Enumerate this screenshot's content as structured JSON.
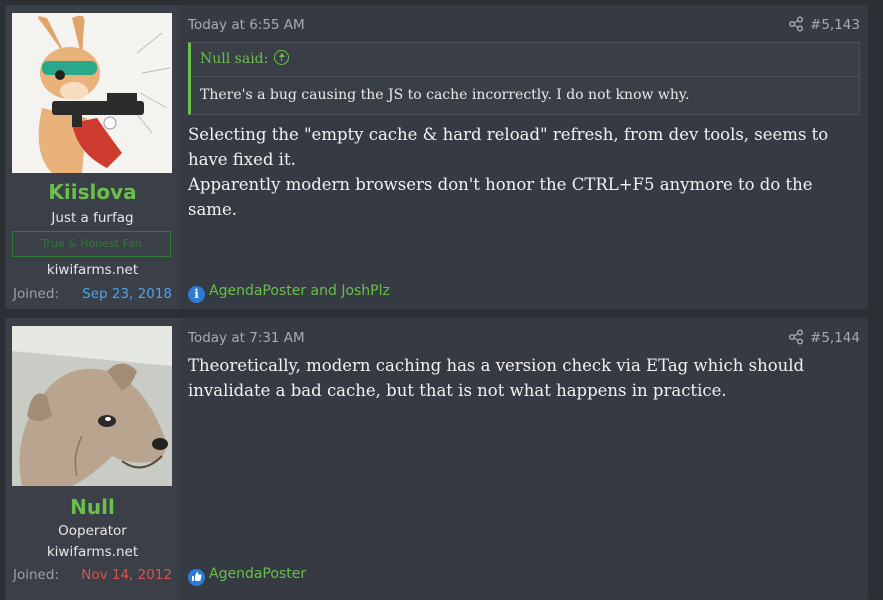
{
  "posts": [
    {
      "user": {
        "name": "Kiislova",
        "title": "Just a furfag",
        "banner": "True & Honest Fan",
        "site": "kiwifarms.net",
        "joined_label": "Joined:",
        "joined_date": "Sep 23, 2018"
      },
      "date": "Today at 6:55 AM",
      "number": "#5,143",
      "quote": {
        "author": "Null said:",
        "text": "There's a bug causing the JS to cache incorrectly. I do not know why."
      },
      "body": [
        "Selecting the \"empty cache & hard reload\" refresh, from dev tools, seems to have fixed it.",
        "Apparently modern browsers don't honor the CTRL+F5 anymore to do the same."
      ],
      "reactions": "AgendaPoster and JoshPlz"
    },
    {
      "user": {
        "name": "Null",
        "title": "Ooperator",
        "site": "kiwifarms.net",
        "joined_label": "Joined:",
        "joined_date": "Nov 14, 2012"
      },
      "date": "Today at 7:31 AM",
      "number": "#5,144",
      "body": [
        "Theoretically, modern caching has a version check via ETag which should invalidate a bad cache, but that is not what happens in practice."
      ],
      "reactions": "AgendaPoster"
    }
  ],
  "icons": {
    "share": "share-icon",
    "info_reaction": "info-reaction-icon",
    "like_reaction": "like-reaction-icon"
  },
  "colors": {
    "username": "#6abf4b",
    "joined_blue": "#4da3f0",
    "joined_red": "#d9534f",
    "quote_accent": "#6abf4b"
  }
}
